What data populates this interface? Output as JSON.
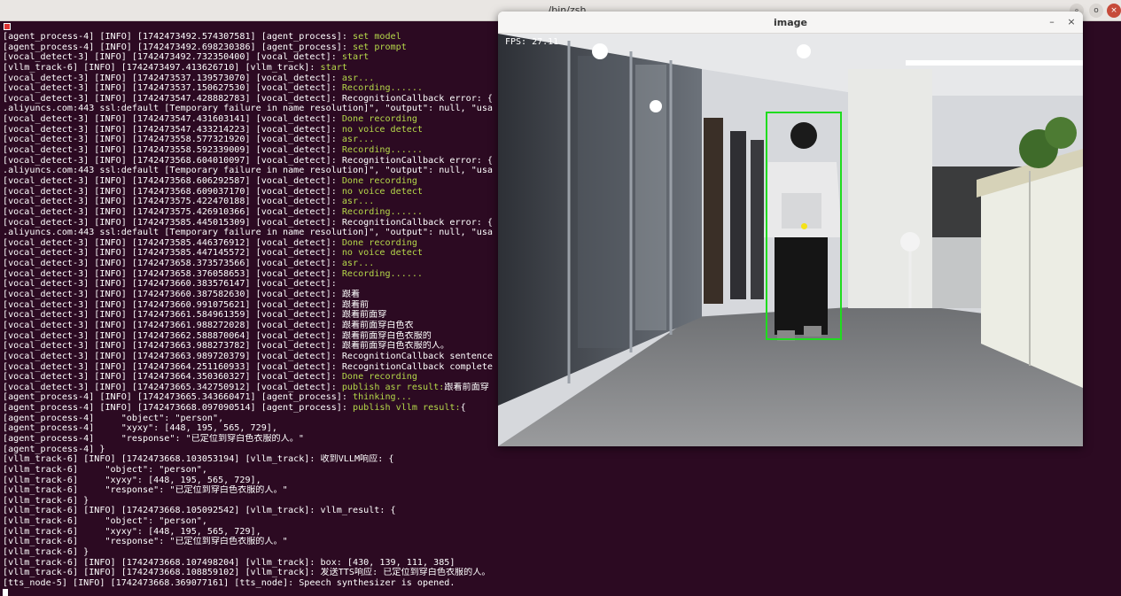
{
  "terminal": {
    "title": "/bin/zsh",
    "lines": [
      [
        {
          "t": "[agent_process-4] [INFO] [1742473492.574307581] [agent_process]: "
        },
        {
          "t": "set model",
          "c": "hl"
        }
      ],
      [
        {
          "t": "[agent_process-4] [INFO] [1742473492.698230386] [agent_process]: "
        },
        {
          "t": "set prompt",
          "c": "hl"
        }
      ],
      [
        {
          "t": "[vocal_detect-3] [INFO] [1742473492.732350400] [vocal_detect]: "
        },
        {
          "t": "start",
          "c": "hl"
        }
      ],
      [
        {
          "t": "[vllm_track-6] [INFO] [1742473497.413626710] [vllm_track]: "
        },
        {
          "t": "start",
          "c": "hl"
        }
      ],
      [
        {
          "t": "[vocal_detect-3] [INFO] [1742473537.139573070] [vocal_detect]: "
        },
        {
          "t": "asr...",
          "c": "hl"
        }
      ],
      [
        {
          "t": "[vocal_detect-3] [INFO] [1742473537.150627530] [vocal_detect]: "
        },
        {
          "t": "Recording......",
          "c": "hl"
        }
      ],
      [
        {
          "t": "[vocal_detect-3] [INFO] [1742473547.428882783] [vocal_detect]: RecognitionCallback error: {                                                                                           shscope"
        }
      ],
      [
        {
          "t": ".aliyuncs.com:443 ssl:default [Temporary failure in name resolution]\", \"output\": null, \"usa"
        }
      ],
      [
        {
          "t": "[vocal_detect-3] [INFO] [1742473547.431603141] [vocal_detect]: "
        },
        {
          "t": "Done recording",
          "c": "hl"
        }
      ],
      [
        {
          "t": "[vocal_detect-3] [INFO] [1742473547.433214223] [vocal_detect]: "
        },
        {
          "t": "no voice detect",
          "c": "hl"
        }
      ],
      [
        {
          "t": "[vocal_detect-3] [INFO] [1742473558.577321920] [vocal_detect]: "
        },
        {
          "t": "asr...",
          "c": "hl"
        }
      ],
      [
        {
          "t": "[vocal_detect-3] [INFO] [1742473558.592339009] [vocal_detect]: "
        },
        {
          "t": "Recording......",
          "c": "hl"
        }
      ],
      [
        {
          "t": "[vocal_detect-3] [INFO] [1742473568.604010097] [vocal_detect]: RecognitionCallback error: {                                                                                           shscope"
        }
      ],
      [
        {
          "t": ".aliyuncs.com:443 ssl:default [Temporary failure in name resolution]\", \"output\": null, \"usa"
        }
      ],
      [
        {
          "t": "[vocal_detect-3] [INFO] [1742473568.606292587] [vocal_detect]: "
        },
        {
          "t": "Done recording",
          "c": "hl"
        }
      ],
      [
        {
          "t": "[vocal_detect-3] [INFO] [1742473568.609037170] [vocal_detect]: "
        },
        {
          "t": "no voice detect",
          "c": "hl"
        }
      ],
      [
        {
          "t": "[vocal_detect-3] [INFO] [1742473575.422470188] [vocal_detect]: "
        },
        {
          "t": "asr...",
          "c": "hl"
        }
      ],
      [
        {
          "t": "[vocal_detect-3] [INFO] [1742473575.426910366] [vocal_detect]: "
        },
        {
          "t": "Recording......",
          "c": "hl"
        }
      ],
      [
        {
          "t": "[vocal_detect-3] [INFO] [1742473585.445015309] [vocal_detect]: RecognitionCallback error: {                                                                                           shscope"
        }
      ],
      [
        {
          "t": ".aliyuncs.com:443 ssl:default [Temporary failure in name resolution]\", \"output\": null, \"usa"
        }
      ],
      [
        {
          "t": "[vocal_detect-3] [INFO] [1742473585.446376912] [vocal_detect]: "
        },
        {
          "t": "Done recording",
          "c": "hl"
        }
      ],
      [
        {
          "t": "[vocal_detect-3] [INFO] [1742473585.447145572] [vocal_detect]: "
        },
        {
          "t": "no voice detect",
          "c": "hl"
        }
      ],
      [
        {
          "t": "[vocal_detect-3] [INFO] [1742473658.373573566] [vocal_detect]: "
        },
        {
          "t": "asr...",
          "c": "hl"
        }
      ],
      [
        {
          "t": "[vocal_detect-3] [INFO] [1742473658.376058653] [vocal_detect]: "
        },
        {
          "t": "Recording......",
          "c": "hl"
        }
      ],
      [
        {
          "t": "[vocal_detect-3] [INFO] [1742473660.383576147] [vocal_detect]:"
        }
      ],
      [
        {
          "t": "[vocal_detect-3] [INFO] [1742473660.387582630] [vocal_detect]: 跟着"
        }
      ],
      [
        {
          "t": "[vocal_detect-3] [INFO] [1742473660.991075621] [vocal_detect]: 跟着前"
        }
      ],
      [
        {
          "t": "[vocal_detect-3] [INFO] [1742473661.584961359] [vocal_detect]: 跟着前面穿"
        }
      ],
      [
        {
          "t": "[vocal_detect-3] [INFO] [1742473661.988272028] [vocal_detect]: 跟着前面穿白色衣"
        }
      ],
      [
        {
          "t": "[vocal_detect-3] [INFO] [1742473662.588870064] [vocal_detect]: 跟着前面穿白色衣服的"
        }
      ],
      [
        {
          "t": "[vocal_detect-3] [INFO] [1742473663.988273782] [vocal_detect]: 跟着前面穿白色衣服的人。"
        }
      ],
      [
        {
          "t": "[vocal_detect-3] [INFO] [1742473663.989720379] [vocal_detect]: RecognitionCallback sentence"
        }
      ],
      [
        {
          "t": "[vocal_detect-3] [INFO] [1742473664.251160933] [vocal_detect]: RecognitionCallback complete"
        }
      ],
      [
        {
          "t": "[vocal_detect-3] [INFO] [1742473664.350360327] [vocal_detect]: "
        },
        {
          "t": "Done recording",
          "c": "hl"
        }
      ],
      [
        {
          "t": "[vocal_detect-3] [INFO] [1742473665.342750912] [vocal_detect]: "
        },
        {
          "t": "publish asr result:",
          "c": "hl"
        },
        {
          "t": "跟着前面穿"
        }
      ],
      [
        {
          "t": "[agent_process-4] [INFO] [1742473665.343660471] [agent_process]: "
        },
        {
          "t": "thinking...",
          "c": "hl"
        }
      ],
      [
        {
          "t": "[agent_process-4] [INFO] [1742473668.097090514] [agent_process]: "
        },
        {
          "t": "publish vllm result:",
          "c": "hl"
        },
        {
          "t": "{"
        }
      ],
      [
        {
          "t": "[agent_process-4]     \"object\": \"person\","
        }
      ],
      [
        {
          "t": "[agent_process-4]     \"xyxy\": [448, 195, 565, 729],"
        }
      ],
      [
        {
          "t": "[agent_process-4]     \"response\": \"已定位到穿白色衣服的人。\""
        }
      ],
      [
        {
          "t": "[agent_process-4] }"
        }
      ],
      [
        {
          "t": "[vllm_track-6] [INFO] [1742473668.103053194] [vllm_track]: 收到VLLM响应: {"
        }
      ],
      [
        {
          "t": "[vllm_track-6]     \"object\": \"person\","
        }
      ],
      [
        {
          "t": "[vllm_track-6]     \"xyxy\": [448, 195, 565, 729],"
        }
      ],
      [
        {
          "t": "[vllm_track-6]     \"response\": \"已定位到穿白色衣服的人。\""
        }
      ],
      [
        {
          "t": "[vllm_track-6] }"
        }
      ],
      [
        {
          "t": "[vllm_track-6] [INFO] [1742473668.105092542] [vllm_track]: vllm_result: {"
        }
      ],
      [
        {
          "t": "[vllm_track-6]     \"object\": \"person\","
        }
      ],
      [
        {
          "t": "[vllm_track-6]     \"xyxy\": [448, 195, 565, 729],"
        }
      ],
      [
        {
          "t": "[vllm_track-6]     \"response\": \"已定位到穿白色衣服的人。\""
        }
      ],
      [
        {
          "t": "[vllm_track-6] }"
        }
      ],
      [
        {
          "t": "[vllm_track-6] [INFO] [1742473668.107498204] [vllm_track]: box: [430, 139, 111, 385]"
        }
      ],
      [
        {
          "t": "[vllm_track-6] [INFO] [1742473668.108859102] [vllm_track]: 发送TTS响应: 已定位到穿白色衣服的人。"
        }
      ],
      [
        {
          "t": "[tts_node-5] [INFO] [1742473668.369077161] [tts_node]: Speech synthesizer is opened."
        }
      ]
    ]
  },
  "image_window": {
    "title": "image",
    "fps_label": "FPS: 27.11",
    "min_icon": "–",
    "close_icon": "×"
  },
  "terminal_window_buttons": {
    "search_icon": "⌕",
    "restore_icon": "o",
    "close_icon": "×"
  },
  "colors": {
    "terminal_bg": "#2c0a22",
    "highlight": "#b5d84a",
    "bbox": "#1fdc1f",
    "center_dot": "#f5e21a"
  }
}
